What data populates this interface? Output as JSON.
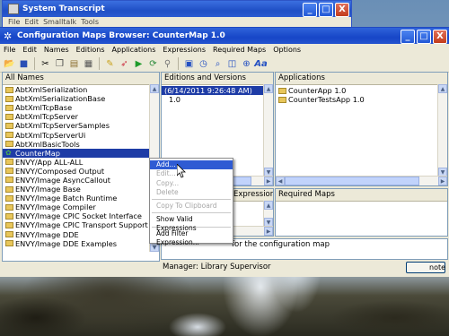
{
  "background_window": {
    "title": "System Transcript",
    "menu": [
      "File",
      "Edit",
      "Smalltalk",
      "Tools"
    ],
    "buttons": {
      "minimize": "_",
      "maximize": "□",
      "close": "X"
    }
  },
  "window": {
    "title": "Configuration Maps Browser: CounterMap 1.0",
    "buttons": {
      "minimize": "_",
      "maximize": "□",
      "close": "X"
    }
  },
  "menubar": [
    "File",
    "Edit",
    "Names",
    "Editions",
    "Applications",
    "Expressions",
    "Required Maps",
    "Options"
  ],
  "toolbar_icons": [
    "open-icon",
    "save-icon",
    "cut-icon",
    "copy-icon",
    "paste-icon",
    "refresh-icon",
    "edit-icon",
    "browse-icon",
    "run-icon",
    "debug-icon",
    "inspect-icon",
    "load-icon",
    "history-icon",
    "lookup-icon",
    "mark-icon",
    "zoom-icon",
    "text-style-icon"
  ],
  "panes": {
    "names": {
      "header": "All Names",
      "items": [
        "AbtXmlSerialization",
        "AbtXmlSerializationBase",
        "AbtXmlTcpBase",
        "AbtXmlTcpServer",
        "AbtXmlTcpServerSamples",
        "AbtXmlTcpServerUi",
        "AbtXmlBasicTools",
        "CounterMap",
        "ENVY/App ALL-ALL",
        "ENVY/Composed Output",
        "ENVY/Image AsyncCallout",
        "ENVY/Image Base",
        "ENVY/Image Batch Runtime",
        "ENVY/Image Compiler",
        "ENVY/Image CPIC Socket Interface",
        "ENVY/Image CPIC Transport Support",
        "ENVY/Image DDE",
        "ENVY/Image DDE Examples"
      ],
      "selected": "CounterMap"
    },
    "editions": {
      "header": "Editions and Versions",
      "items": [
        "(6/14/2011 9:26:48 AM)",
        "1.0"
      ],
      "selected": "(6/14/2011 9:26:48 AM)"
    },
    "applications": {
      "header": "Applications",
      "items": [
        "CounterApp 1.0",
        "CounterTestsApp 1.0"
      ]
    },
    "expressions": {
      "header": "Expressions"
    },
    "required_maps": {
      "header": "Required Maps"
    },
    "notes_text": "for the configuration map"
  },
  "context_menu": {
    "items": [
      {
        "label": "Add...",
        "disabled": false,
        "highlighted": true
      },
      {
        "label": "Edit...",
        "disabled": true
      },
      {
        "label": "Copy...",
        "disabled": true
      },
      {
        "label": "Delete",
        "disabled": true
      },
      {
        "separator": true
      },
      {
        "label": "Copy To Clipboard",
        "disabled": true
      },
      {
        "separator": true
      },
      {
        "label": "Show Valid Expressions",
        "disabled": false
      },
      {
        "separator": true
      },
      {
        "label": "Add Filter Expression...",
        "disabled": false
      }
    ]
  },
  "status": {
    "manager": "Manager: Library Supervisor",
    "notes_button": "note"
  },
  "colors": {
    "titlebar": "#1746c7",
    "selection": "#1e3ca6",
    "menu_highlight": "#2f5bd3",
    "chrome": "#ece9d8"
  }
}
